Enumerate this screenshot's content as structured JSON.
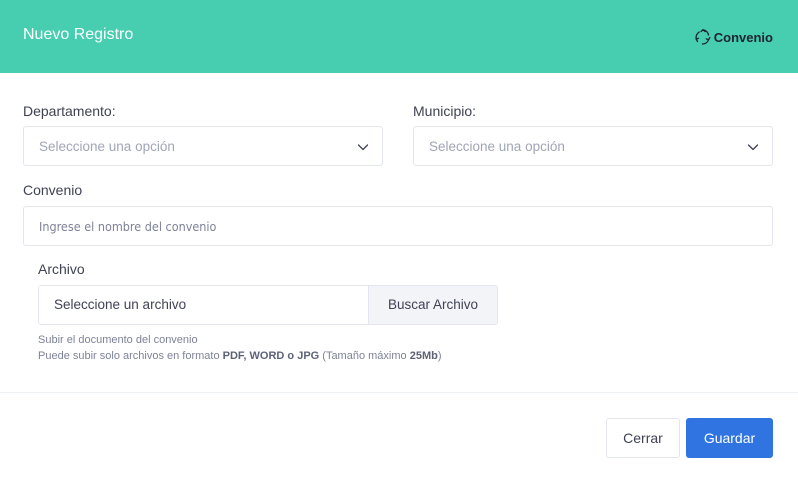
{
  "header": {
    "title": "Nuevo Registro",
    "brand_label": "Convenio",
    "brand_icon": "recycle-icon",
    "background_color": "#47cdb0"
  },
  "form": {
    "departamento": {
      "label": "Departamento:",
      "selected": "Seleccione una opción"
    },
    "municipio": {
      "label": "Municipio:",
      "selected": "Seleccione una opción"
    },
    "convenio": {
      "label": "Convenio",
      "placeholder": "Ingrese el nombre del convenio",
      "value": ""
    },
    "archivo": {
      "label": "Archivo",
      "file_name": "Seleccione un archivo",
      "browse_label": "Buscar Archivo",
      "hint_line1": "Subir el documento del convenio",
      "hint_prefix": "Puede subir solo archivos en formato ",
      "hint_formats": "PDF, WORD o JPG",
      "hint_middle": " (Tamaño máximo ",
      "hint_max_size": "25Mb",
      "hint_suffix": ")"
    }
  },
  "footer": {
    "close_label": "Cerrar",
    "save_label": "Guardar",
    "save_color": "#2f74e0"
  }
}
